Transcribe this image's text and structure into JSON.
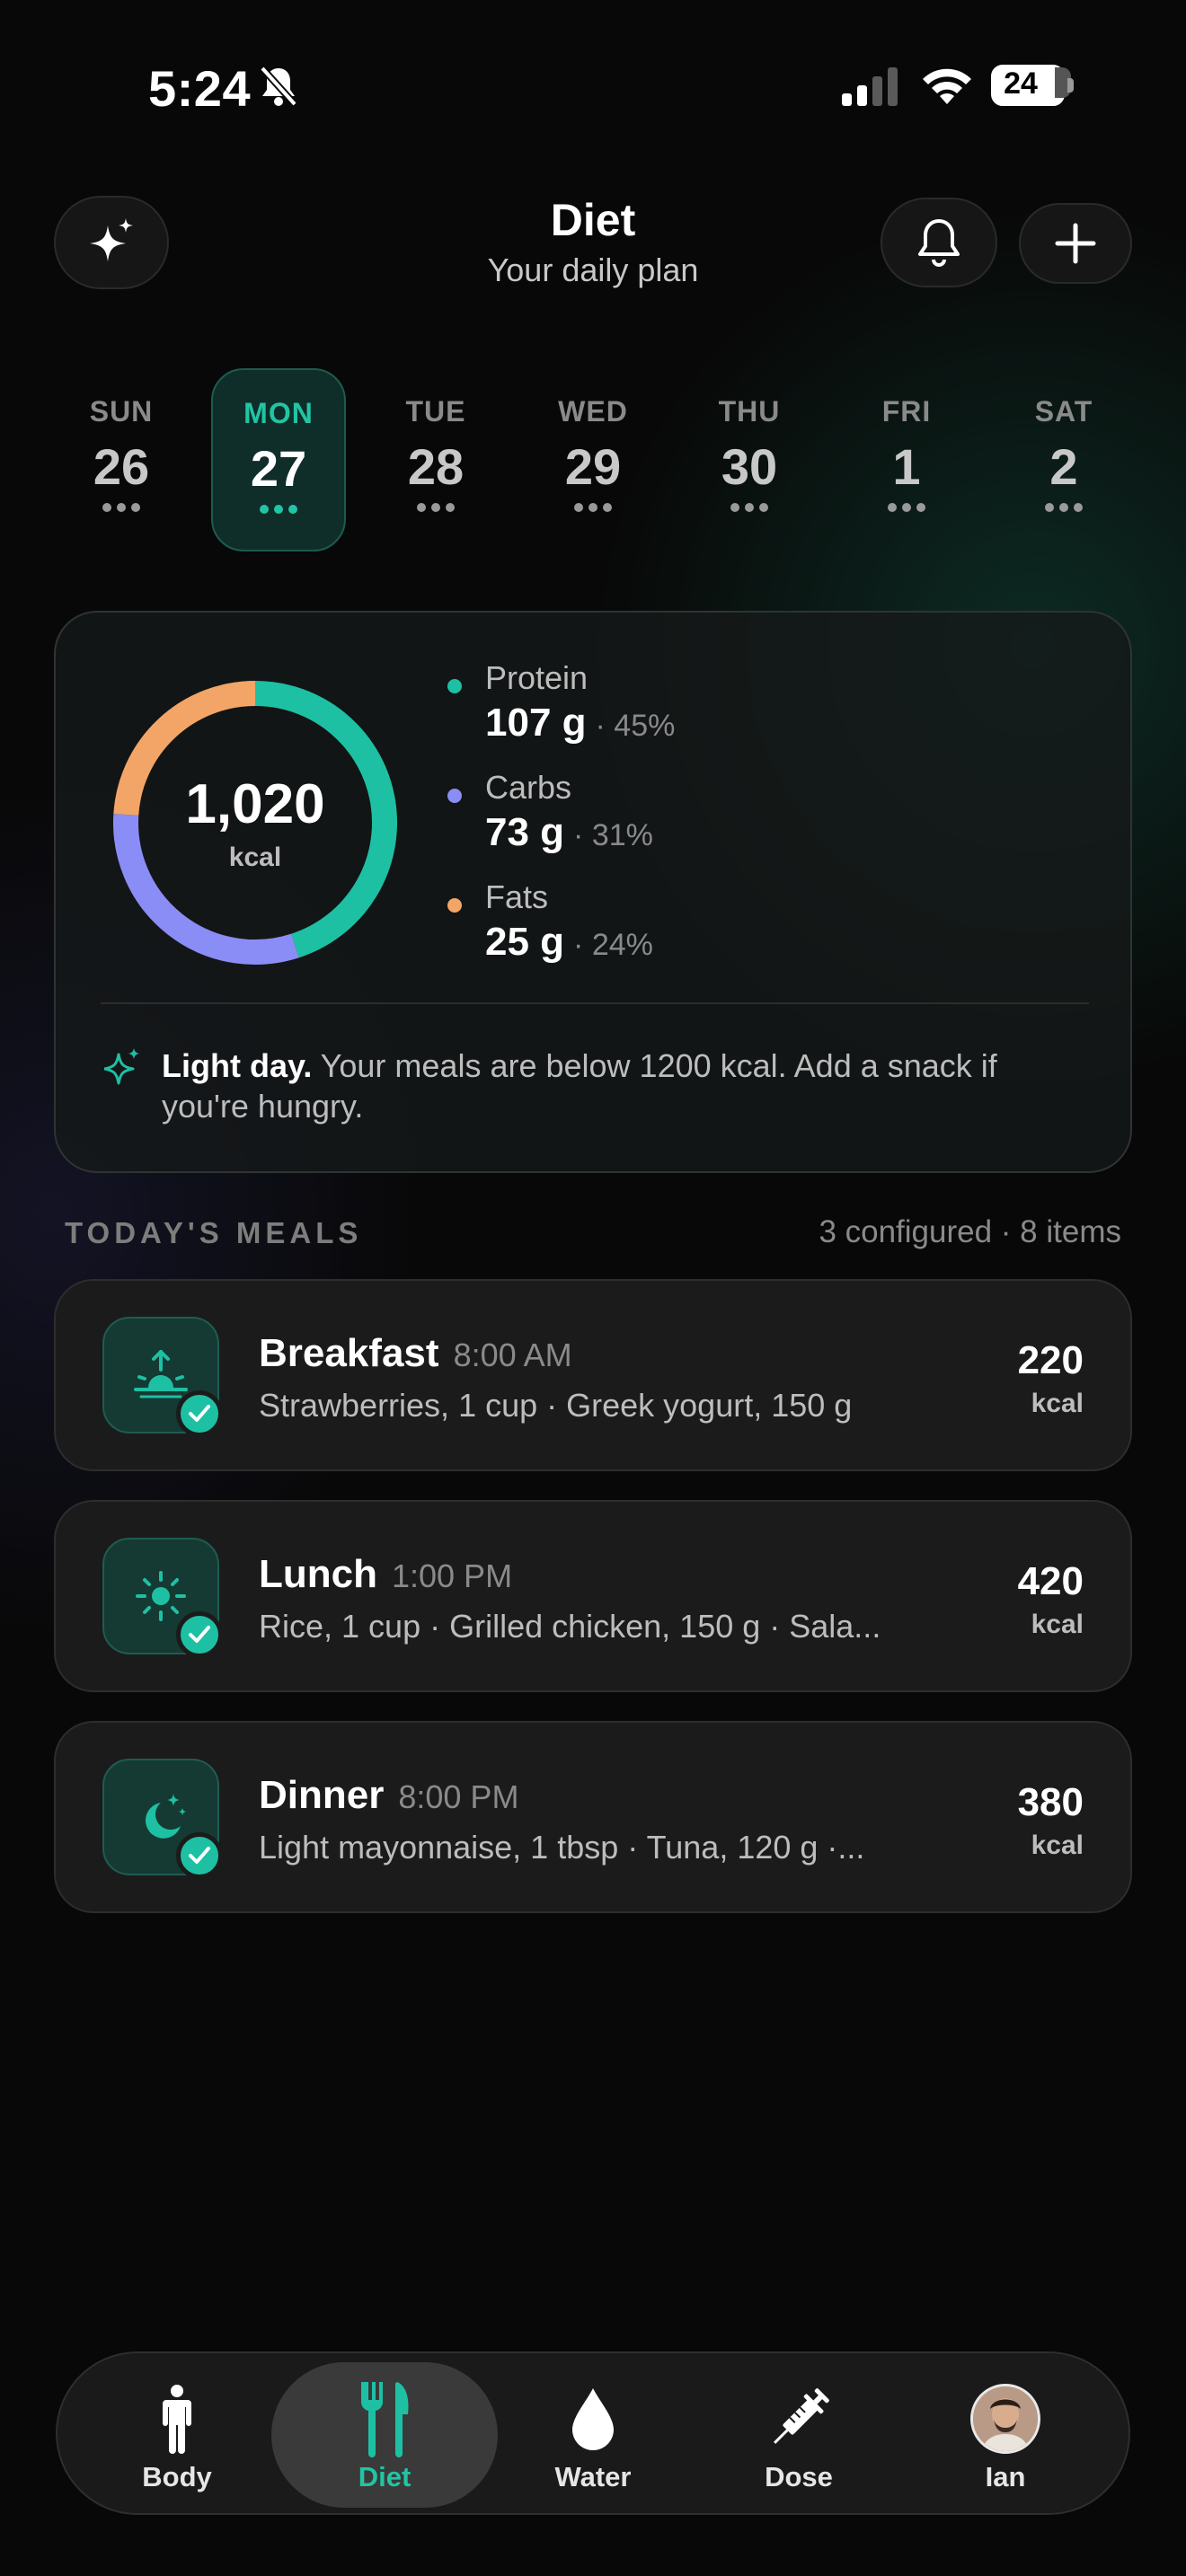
{
  "status": {
    "time": "5:24",
    "battery": "24"
  },
  "header": {
    "title": "Diet",
    "subtitle": "Your daily plan"
  },
  "days": [
    {
      "name": "SUN",
      "num": "26",
      "selected": false
    },
    {
      "name": "MON",
      "num": "27",
      "selected": true
    },
    {
      "name": "TUE",
      "num": "28",
      "selected": false
    },
    {
      "name": "WED",
      "num": "29",
      "selected": false
    },
    {
      "name": "THU",
      "num": "30",
      "selected": false
    },
    {
      "name": "FRI",
      "num": "1",
      "selected": false
    },
    {
      "name": "SAT",
      "num": "2",
      "selected": false
    }
  ],
  "summary": {
    "kcal": "1,020",
    "kcal_unit": "kcal",
    "macros": [
      {
        "name": "Protein",
        "value": "107 g",
        "pct": "· 45%",
        "color": "#1ec0a3",
        "fraction": 0.45
      },
      {
        "name": "Carbs",
        "value": "73 g",
        "pct": "· 31%",
        "color": "#8a8df5",
        "fraction": 0.31
      },
      {
        "name": "Fats",
        "value": "25 g",
        "pct": "· 24%",
        "color": "#f3a567",
        "fraction": 0.24
      }
    ],
    "tip_bold": "Light day.",
    "tip_text": " Your meals are below 1200 kcal. Add a snack if you're hungry."
  },
  "meals_section": {
    "title": "TODAY'S MEALS",
    "meta": "3 configured · 8 items"
  },
  "meals": [
    {
      "name": "Breakfast",
      "time": "8:00 AM",
      "items": "Strawberries, 1 cup · Greek yogurt, 150 g",
      "kcal": "220",
      "unit": "kcal",
      "icon": "sunrise-icon"
    },
    {
      "name": "Lunch",
      "time": "1:00 PM",
      "items": "Rice, 1 cup · Grilled chicken, 150 g · Sala...",
      "kcal": "420",
      "unit": "kcal",
      "icon": "sun-icon"
    },
    {
      "name": "Dinner",
      "time": "8:00 PM",
      "items": "Light mayonnaise, 1 tbsp · Tuna, 120 g ·...",
      "kcal": "380",
      "unit": "kcal",
      "icon": "moon-icon"
    }
  ],
  "tabs": [
    {
      "label": "Body",
      "icon": "body-icon"
    },
    {
      "label": "Diet",
      "icon": "fork-knife-icon",
      "active": true
    },
    {
      "label": "Water",
      "icon": "water-drop-icon"
    },
    {
      "label": "Dose",
      "icon": "syringe-icon"
    },
    {
      "label": "Ian",
      "icon": "avatar"
    }
  ],
  "colors": {
    "accent": "#1ec0a3",
    "carbs": "#8a8df5",
    "fats": "#f3a567"
  }
}
